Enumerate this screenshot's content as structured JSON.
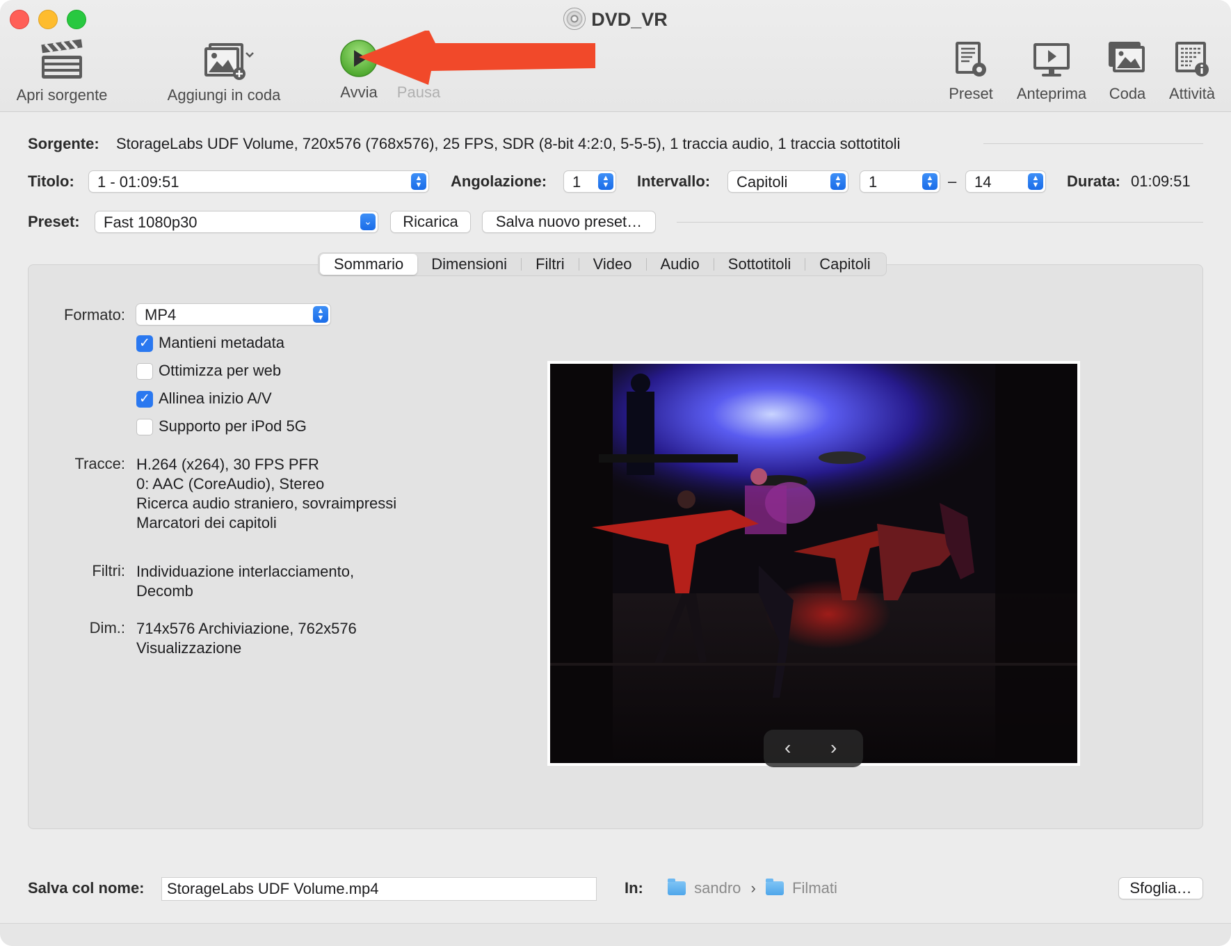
{
  "window": {
    "title": "DVD_VR"
  },
  "toolbar": {
    "open_source": "Apri sorgente",
    "add_to_queue": "Aggiungi in coda",
    "start": "Avvia",
    "pause": "Pausa",
    "presets": "Preset",
    "preview": "Anteprima",
    "queue": "Coda",
    "activity": "Attività"
  },
  "source": {
    "label": "Sorgente:",
    "value": "StorageLabs UDF Volume, 720x576 (768x576), 25 FPS, SDR (8-bit 4:2:0, 5-5-5), 1 traccia audio, 1 traccia sottotitoli"
  },
  "title_row": {
    "title_label": "Titolo:",
    "title_value": "1 - 01:09:51",
    "angle_label": "Angolazione:",
    "angle_value": "1",
    "range_label": "Intervallo:",
    "range_type": "Capitoli",
    "range_start": "1",
    "range_dash": "–",
    "range_end": "14",
    "duration_label": "Durata:",
    "duration_value": "01:09:51"
  },
  "preset_row": {
    "label": "Preset:",
    "value": "Fast 1080p30",
    "reload_button": "Ricarica",
    "save_new_button": "Salva nuovo preset…"
  },
  "tabs": [
    "Sommario",
    "Dimensioni",
    "Filtri",
    "Video",
    "Audio",
    "Sottotitoli",
    "Capitoli"
  ],
  "summary": {
    "format_label": "Formato:",
    "format_value": "MP4",
    "checkboxes": [
      {
        "label": "Mantieni metadata",
        "checked": true
      },
      {
        "label": "Ottimizza per web",
        "checked": false
      },
      {
        "label": "Allinea inizio A/V",
        "checked": true
      },
      {
        "label": "Supporto per iPod 5G",
        "checked": false
      }
    ],
    "tracks_label": "Tracce:",
    "tracks": [
      "H.264 (x264), 30 FPS PFR",
      "0: AAC (CoreAudio), Stereo",
      "Ricerca audio straniero, sovraimpressi",
      "Marcatori dei capitoli"
    ],
    "filters_label": "Filtri:",
    "filters": [
      "Individuazione interlacciamento,",
      "Decomb"
    ],
    "dims_label": "Dim.:",
    "dims": [
      "714x576 Archiviazione, 762x576",
      "Visualizzazione"
    ]
  },
  "preview_nav": {
    "prev": "‹",
    "next": "›"
  },
  "save": {
    "label": "Salva col nome:",
    "filename": "StorageLabs UDF Volume.mp4",
    "in_label": "In:",
    "path": [
      "sandro",
      "Filmati"
    ],
    "path_sep": "›",
    "browse_button": "Sfoglia…"
  },
  "colors": {
    "accent": "#2a78f0",
    "start_button": "#5dbb3a",
    "annotation_arrow": "#f1492a"
  }
}
